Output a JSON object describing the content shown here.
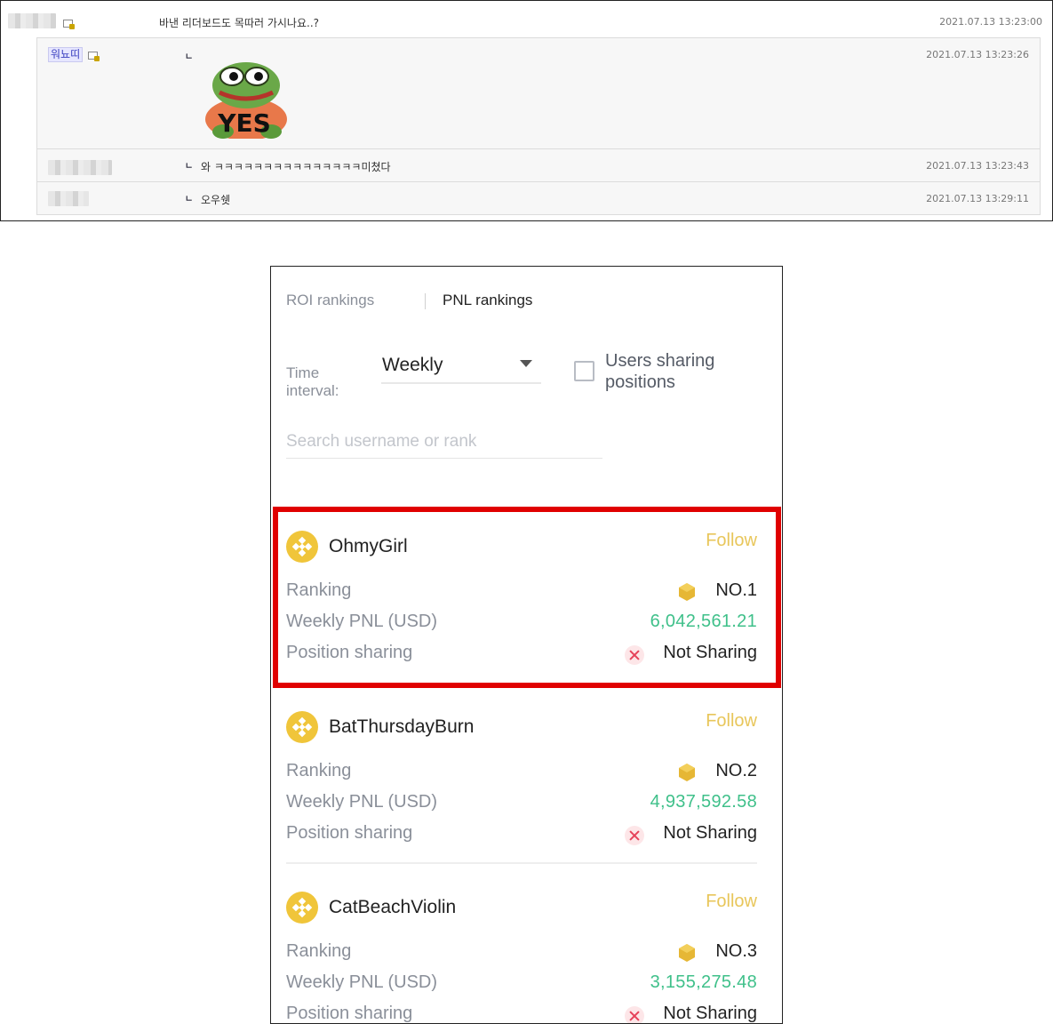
{
  "comments": {
    "top": {
      "text": "바낸 리더보드도 목따러 가시나요..?",
      "date": "2021.07.13 13:23:00"
    },
    "replies": [
      {
        "author": "워뇨띠",
        "mark": "ㄴ",
        "text": "",
        "sticker_text": "YES",
        "date": "2021.07.13 13:23:26"
      },
      {
        "author": "",
        "mark": "ㄴ",
        "text": "와 ㅋㅋㅋㅋㅋㅋㅋㅋㅋㅋㅋㅋㅋㅋㅋ미쳤다",
        "date": "2021.07.13 13:23:43"
      },
      {
        "author": "",
        "mark": "ㄴ",
        "text": "오우쉣",
        "date": "2021.07.13 13:29:11"
      }
    ]
  },
  "app": {
    "tabs": [
      {
        "label": "ROI rankings"
      },
      {
        "label": "PNL rankings"
      }
    ],
    "interval_label": "Time interval:",
    "interval_value": "Weekly",
    "sharing_label": "Users sharing positions",
    "search_placeholder": "Search username or rank",
    "row_labels": {
      "ranking": "Ranking",
      "pnl": "Weekly PNL (USD)",
      "sharing": "Position sharing"
    },
    "follow_label": "Follow",
    "leaders": [
      {
        "name": "OhmyGirl",
        "rank": "NO.1",
        "pnl": "6,042,561.21",
        "sharing": "Not Sharing"
      },
      {
        "name": "BatThursdayBurn",
        "rank": "NO.2",
        "pnl": "4,937,592.58",
        "sharing": "Not Sharing"
      },
      {
        "name": "CatBeachViolin",
        "rank": "NO.3",
        "pnl": "3,155,275.48",
        "sharing": "Not Sharing"
      }
    ],
    "colors": {
      "follow": "#e8c65a",
      "pnl": "#3fc08a",
      "highlight": "#e00000",
      "avatar": "#f0c53a"
    }
  }
}
